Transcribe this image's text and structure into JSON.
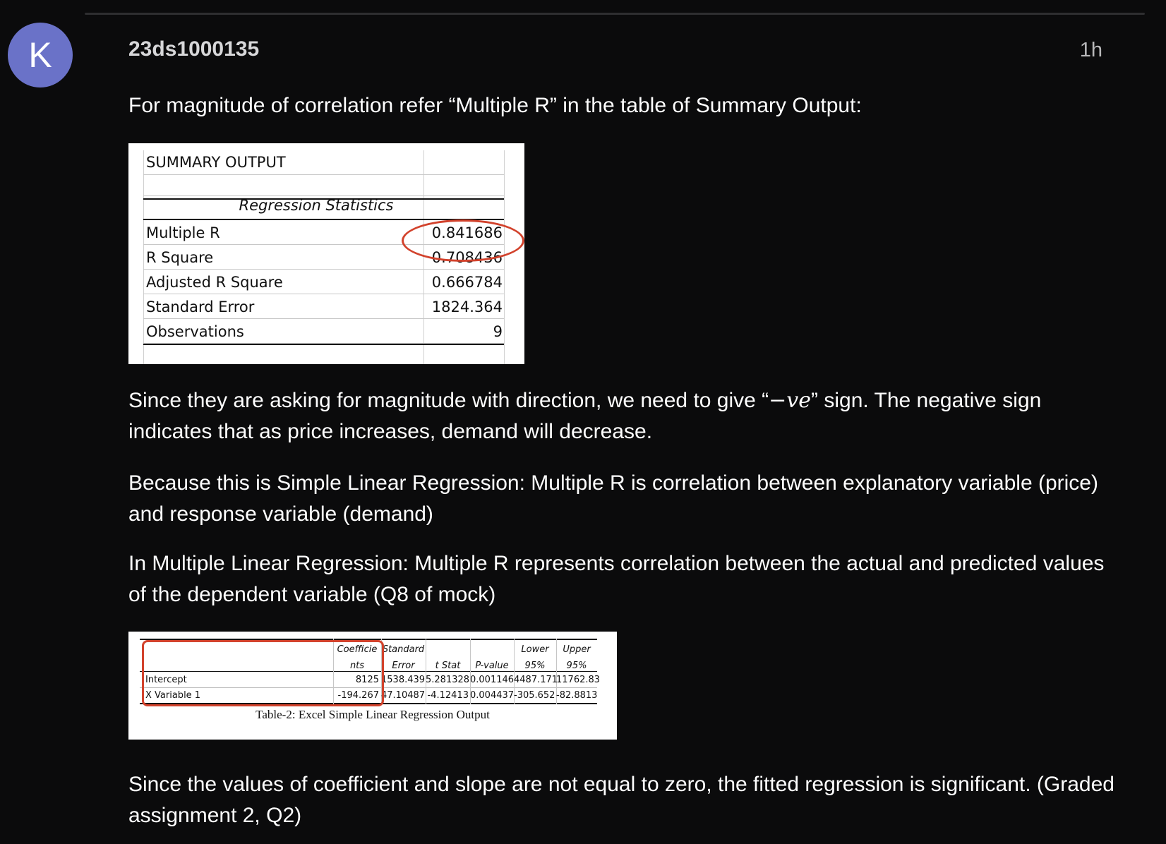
{
  "post": {
    "avatar_letter": "K",
    "username": "23ds1000135",
    "time": "1h"
  },
  "paragraphs": {
    "p1": "For magnitude of correlation refer “Multiple R” in the table of Summary Output:",
    "p2_before": "Since they are asking for magnitude with direction, we need to give “",
    "p2_math": "−ve",
    "p2_after": "” sign. The negative sign indicates that as price increases, demand will decrease.",
    "p3": "Because this is Simple Linear Regression: Multiple R is correlation between explanatory variable (price) and response variable (demand)",
    "p4": "In Multiple Linear Regression: Multiple R represents correlation between the actual and predicted values of the dependent variable (Q8 of mock)",
    "p5": "Since the values of coefficient and slope are not equal to zero, the fitted regression is significant. (Graded assignment 2, Q2)"
  },
  "summary_output": {
    "title": "SUMMARY OUTPUT",
    "section": "Regression Statistics",
    "rows": [
      {
        "label": "Multiple R",
        "value": "0.841686"
      },
      {
        "label": "R Square",
        "value": "0.708436"
      },
      {
        "label": "Adjusted R Square",
        "value": "0.666784"
      },
      {
        "label": "Standard Error",
        "value": "1824.364"
      },
      {
        "label": "Observations",
        "value": "9"
      }
    ]
  },
  "regression_table": {
    "headers": [
      {
        "line1": "Coefficie",
        "line2": "nts"
      },
      {
        "line1": "Standard",
        "line2": "Error"
      },
      {
        "line1": "",
        "line2": "t Stat"
      },
      {
        "line1": "",
        "line2": "P-value"
      },
      {
        "line1": "Lower",
        "line2": "95%"
      },
      {
        "line1": "Upper",
        "line2": "95%"
      }
    ],
    "rows": [
      {
        "label": "Intercept",
        "values": [
          "8125",
          "1538.439",
          "5.281328",
          "0.001146",
          "4487.171",
          "11762.83"
        ]
      },
      {
        "label": "X Variable 1",
        "values": [
          "-194.267",
          "47.10487",
          "-4.12413",
          "0.004437",
          "-305.652",
          "-82.8813"
        ]
      }
    ],
    "caption": "Table-2: Excel Simple Linear Regression Output"
  },
  "colors": {
    "background": "#0b0b0c",
    "avatar": "#6a72c8",
    "highlight": "#d2422c"
  }
}
